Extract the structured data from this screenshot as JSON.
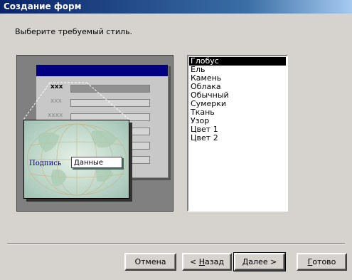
{
  "window": {
    "title": "Создание форм"
  },
  "instruction": "Выберите требуемый стиль.",
  "preview": {
    "row_labels": [
      "xxx",
      "xxx",
      "xxxx"
    ],
    "caption_label": "Подпись",
    "data_field_value": "Данные"
  },
  "styles": {
    "selected": "Глобус",
    "items": [
      "Глобус",
      "Ель",
      "Камень",
      "Облака",
      "Обычный",
      "Сумерки",
      "Ткань",
      "Узор",
      "Цвет 1",
      "Цвет 2"
    ]
  },
  "buttons": {
    "cancel": "Отмена",
    "back_prefix": "< ",
    "back_key": "Н",
    "back_rest": "азад",
    "next_key": "Д",
    "next_rest": "алее >",
    "finish_key": "Г",
    "finish_rest": "отово"
  },
  "colors": {
    "titlebar": "#0a246a",
    "selection": "#000000",
    "preview_bg": "#808080"
  }
}
